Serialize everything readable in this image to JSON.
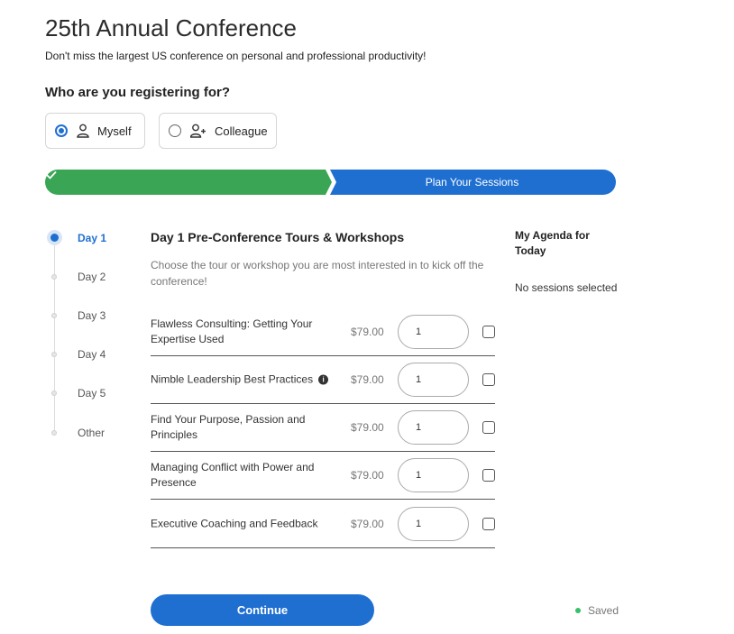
{
  "header": {
    "title": "25th Annual Conference",
    "subtitle": "Don't miss the largest US conference on personal and professional productivity!"
  },
  "registration": {
    "question": "Who are you registering for?",
    "options": [
      {
        "label": "Myself",
        "selected": true,
        "icon": "person-icon"
      },
      {
        "label": "Colleague",
        "selected": false,
        "icon": "person-add-icon"
      }
    ]
  },
  "progress": {
    "completed_icon": "check-icon",
    "current_step_label": "Plan Your Sessions",
    "colors": {
      "completed": "#3aa655",
      "current": "#1f6fd1"
    }
  },
  "days": [
    {
      "label": "Day 1",
      "active": true
    },
    {
      "label": "Day 2",
      "active": false
    },
    {
      "label": "Day 3",
      "active": false
    },
    {
      "label": "Day 4",
      "active": false
    },
    {
      "label": "Day 5",
      "active": false
    },
    {
      "label": "Other",
      "active": false
    }
  ],
  "section": {
    "title": "Day 1 Pre-Conference Tours & Workshops",
    "description": "Choose the tour or workshop you are most interested in to kick off the conference!"
  },
  "sessions": [
    {
      "name": "Flawless Consulting: Getting Your Expertise Used",
      "price": "$79.00",
      "qty": "1",
      "checked": false
    },
    {
      "name": "Nimble Leadership Best Practices",
      "price": "$79.00",
      "qty": "1",
      "checked": false,
      "info_icon": "info-icon"
    },
    {
      "name": "Find Your Purpose, Passion and Principles",
      "price": "$79.00",
      "qty": "1",
      "checked": false
    },
    {
      "name": "Managing Conflict with Power and Presence",
      "price": "$79.00",
      "qty": "1",
      "checked": false
    },
    {
      "name": "Executive Coaching and Feedback",
      "price": "$79.00",
      "qty": "1",
      "checked": false
    }
  ],
  "agenda": {
    "title": "My Agenda for Today",
    "empty_text": "No sessions selected"
  },
  "footer": {
    "continue_label": "Continue",
    "status_text": "Saved",
    "status_color": "#35c06a",
    "accent": "#1f6fd1"
  }
}
